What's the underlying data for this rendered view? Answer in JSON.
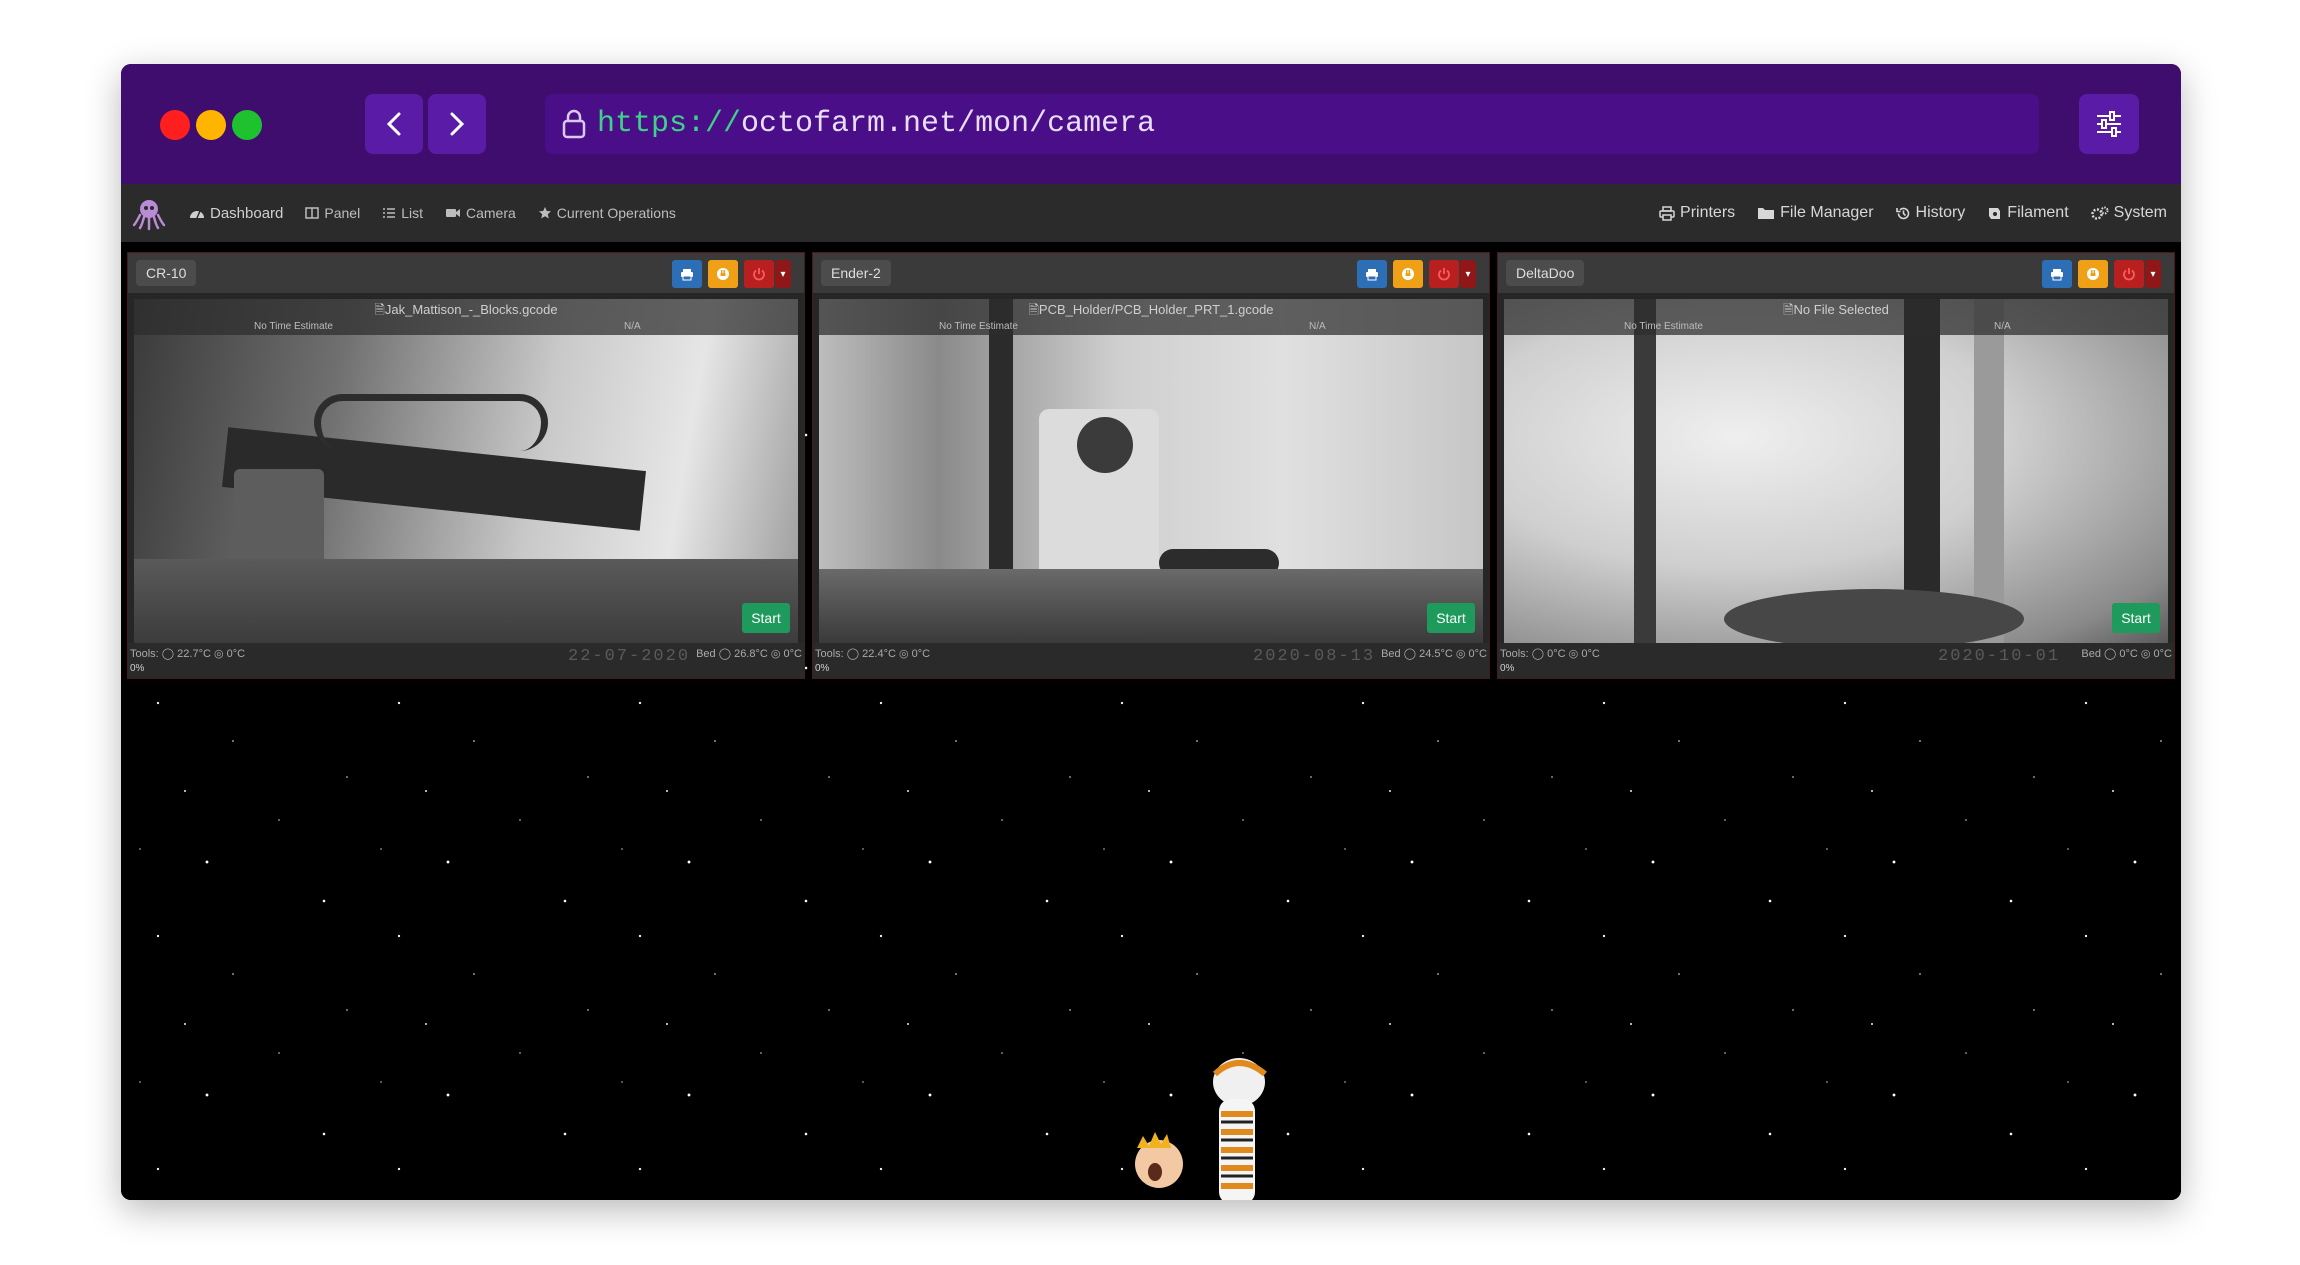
{
  "browser": {
    "url_scheme": "https://",
    "url_rest": "octofarm.net/mon/camera"
  },
  "nav": {
    "left": [
      {
        "label": "Dashboard",
        "icon": "dashboard-icon"
      },
      {
        "label": "Panel",
        "icon": "panel-icon"
      },
      {
        "label": "List",
        "icon": "list-icon"
      },
      {
        "label": "Camera",
        "icon": "camera-icon"
      },
      {
        "label": "Current Operations",
        "icon": "star-icon"
      }
    ],
    "right": [
      {
        "label": "Printers",
        "icon": "printer-icon"
      },
      {
        "label": "File Manager",
        "icon": "folder-icon"
      },
      {
        "label": "History",
        "icon": "history-icon"
      },
      {
        "label": "Filament",
        "icon": "filament-icon"
      },
      {
        "label": "System",
        "icon": "cogs-icon"
      }
    ]
  },
  "printers": [
    {
      "name": "CR-10",
      "file": "Jak_Mattison_-_Blocks.gcode",
      "time_estimate": "No Time Estimate",
      "eta": "N/A",
      "start_label": "Start",
      "tools": "Tools: ◯ 22.7°C ◎ 0°C",
      "bed": "Bed ◯ 26.8°C ◎ 0°C",
      "progress": "0%",
      "stamp": "22-07-2020"
    },
    {
      "name": "Ender-2",
      "file": "PCB_Holder/PCB_Holder_PRT_1.gcode",
      "time_estimate": "No Time Estimate",
      "eta": "N/A",
      "start_label": "Start",
      "tools": "Tools: ◯ 22.4°C ◎ 0°C",
      "bed": "Bed ◯ 24.5°C ◎ 0°C",
      "progress": "0%",
      "stamp": "2020-08-13"
    },
    {
      "name": "DeltaDoo",
      "file": "No File Selected",
      "time_estimate": "No Time Estimate",
      "eta": "N/A",
      "start_label": "Start",
      "tools": "Tools: ◯ 0°C ◎ 0°C",
      "bed": "Bed ◯ 0°C ◎ 0°C",
      "progress": "0%",
      "stamp": "2020-10-01"
    }
  ]
}
